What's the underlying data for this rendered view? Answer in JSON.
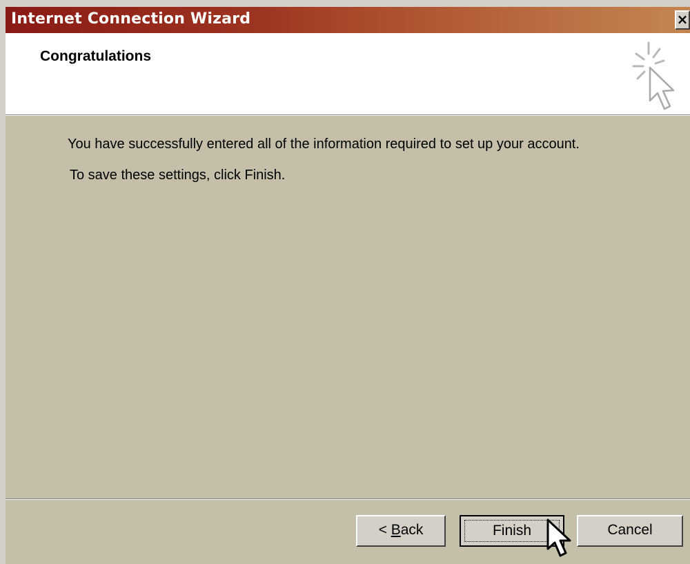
{
  "window": {
    "title": "Internet Connection Wizard",
    "close_label": "×"
  },
  "header": {
    "title": "Congratulations",
    "icon": "wizard-cursor-sparkle-icon"
  },
  "body": {
    "line1": "You have successfully entered all of the information required to set up your account.",
    "line2": "To save these settings, click Finish."
  },
  "buttons": {
    "back_prefix": "< ",
    "back_mnemonic": "B",
    "back_rest": "ack",
    "finish": "Finish",
    "cancel": "Cancel"
  },
  "colors": {
    "title_gradient_start": "#8a1a14",
    "title_gradient_end": "#c48650",
    "panel": "#c4bfa9",
    "button_face": "#d4d0c8"
  }
}
